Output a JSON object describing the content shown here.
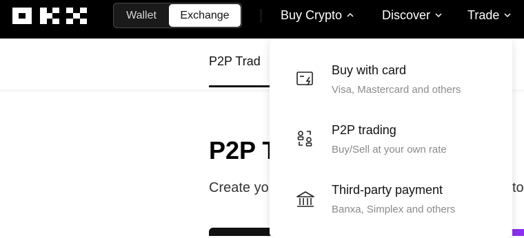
{
  "header": {
    "logo_text": "OKX",
    "segments": {
      "wallet": "Wallet",
      "exchange": "Exchange"
    },
    "nav": [
      {
        "label": "Buy Crypto",
        "icon": "chevron-up-icon"
      },
      {
        "label": "Discover",
        "icon": "chevron-down-icon"
      },
      {
        "label": "Trade",
        "icon": "chevron-down-icon"
      }
    ]
  },
  "subnav": {
    "active_tab": "P2P Trad"
  },
  "main": {
    "title": "P2P T",
    "subtitle": "Create yo",
    "subtitle_tail": "to"
  },
  "dropdown": {
    "items": [
      {
        "icon": "card-lightning-icon",
        "title": "Buy with card",
        "desc": "Visa, Mastercard and others"
      },
      {
        "icon": "p2p-people-icon",
        "title": "P2P trading",
        "desc": "Buy/Sell at your own rate"
      },
      {
        "icon": "bank-icon",
        "title": "Third-party payment",
        "desc": "Banxa, Simplex and others"
      }
    ]
  },
  "colors": {
    "topbar": "#000000",
    "accent": "#8b2ff0",
    "muted": "#8a8a8a"
  }
}
